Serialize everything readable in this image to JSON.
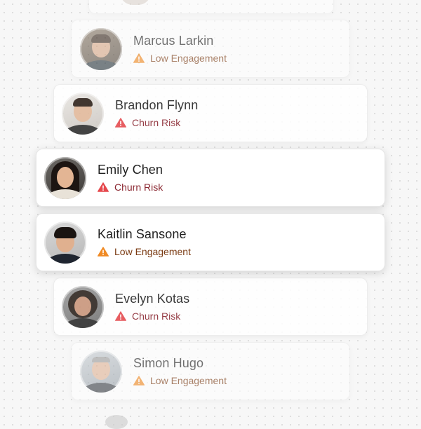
{
  "contacts": [
    {
      "name": "Marcus Larkin",
      "status": "Low Engagement",
      "severity": "low",
      "avatar_icon": "person-avatar-icon"
    },
    {
      "name": "Brandon Flynn",
      "status": "Churn Risk",
      "severity": "churn",
      "avatar_icon": "person-avatar-icon"
    },
    {
      "name": "Emily Chen",
      "status": "Churn Risk",
      "severity": "churn",
      "avatar_icon": "person-avatar-icon"
    },
    {
      "name": "Kaitlin Sansone",
      "status": "Low Engagement",
      "severity": "low",
      "avatar_icon": "person-avatar-icon"
    },
    {
      "name": "Evelyn Kotas",
      "status": "Churn Risk",
      "severity": "churn",
      "avatar_icon": "person-avatar-icon"
    },
    {
      "name": "Simon Hugo",
      "status": "Low Engagement",
      "severity": "low",
      "avatar_icon": "person-avatar-icon"
    }
  ],
  "colors": {
    "churn_icon": "#e5484d",
    "low_icon": "#f08a24",
    "background": "#f7f7f7",
    "card": "#ffffff"
  }
}
